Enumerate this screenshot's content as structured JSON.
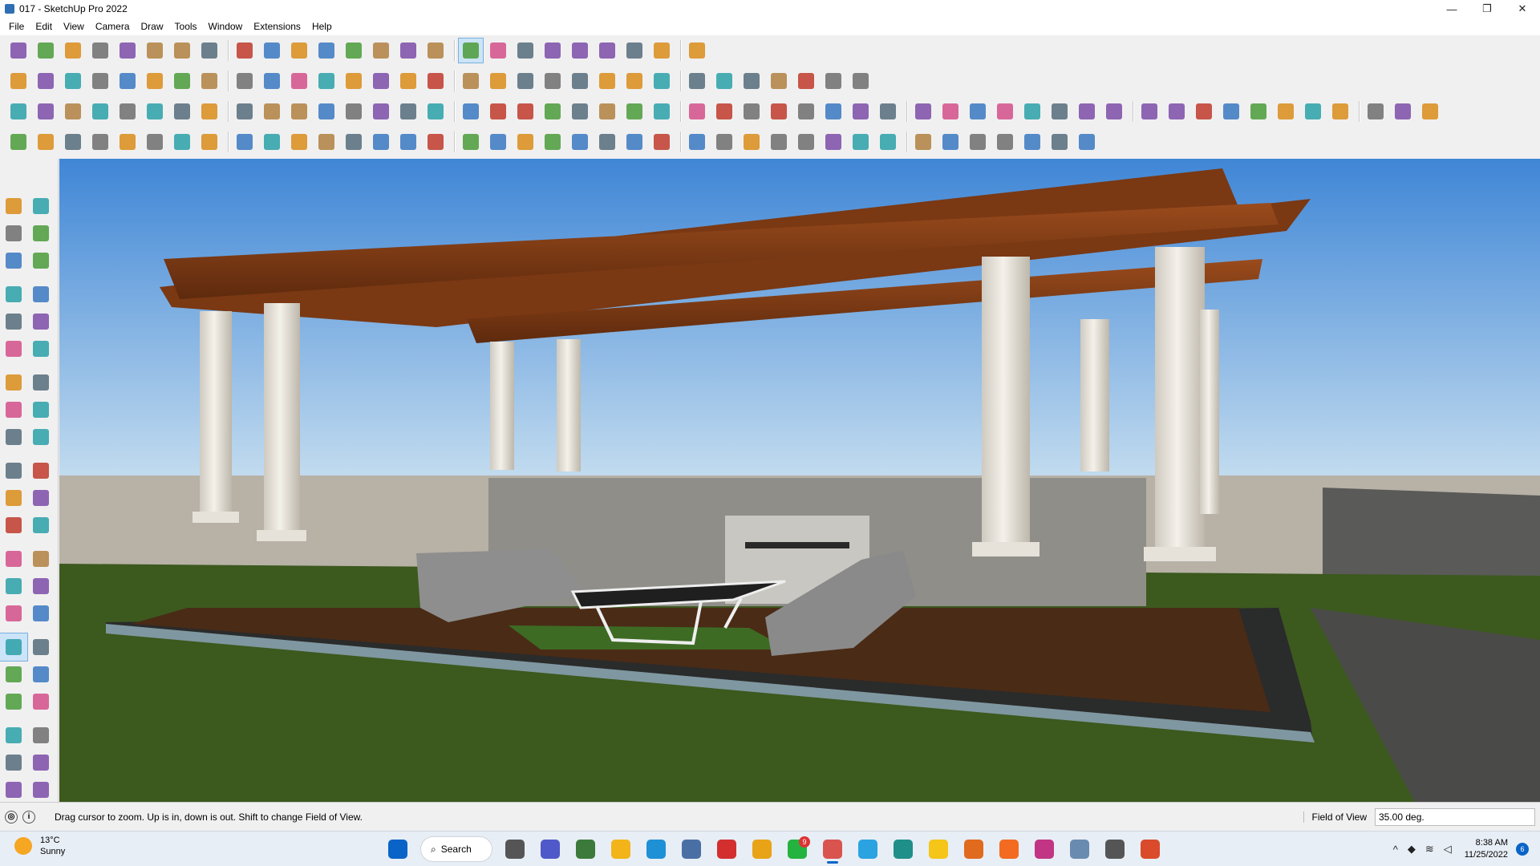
{
  "window": {
    "title": "017 - SketchUp Pro 2022",
    "minimize_glyph": "—",
    "maximize_glyph": "❐",
    "close_glyph": "✕"
  },
  "menu": [
    "File",
    "Edit",
    "View",
    "Camera",
    "Draw",
    "Tools",
    "Window",
    "Extensions",
    "Help"
  ],
  "toolbars": {
    "row1": [
      "search-icon",
      "select-icon",
      "eraser-icon",
      "line-icon",
      "arc-icon",
      "rectangle-icon",
      "push-pull-icon",
      "follow-me-icon",
      "move-icon",
      "rotate-icon",
      "scale-icon",
      "tape-measure-icon",
      "text-icon",
      "paint-bucket-icon",
      "orbit-icon",
      "pan-icon",
      "zoom-icon",
      "zoom-extents-icon",
      "warehouse-icon",
      "extension-warehouse-icon",
      "layout-icon",
      "extension-manager-icon",
      "profile-icon",
      "sandbox-icon",
      "tag-icon"
    ],
    "row2": [
      "warehouse-house-icon",
      "box-icon",
      "section-icon",
      "xray-icon",
      "wireframe-icon",
      "hidden-line-icon",
      "shaded-icon",
      "textured-icon",
      "monochrome-icon",
      "solid-union-icon",
      "solid-subtract-icon",
      "solid-trim-icon",
      "paint-icon",
      "pencil-icon",
      "circle-icon",
      "polygon-icon",
      "ellipse-icon",
      "parallelogram-icon",
      "curve-icon",
      "oval-icon",
      "cloud-icon",
      "arrow-icon",
      "eraser2-icon",
      "push-red-icon",
      "push-blue-icon",
      "push-green-icon",
      "push-orange-icon",
      "push-purple-icon",
      "push-gold-icon",
      "tree-icon",
      "plant-icon"
    ],
    "row3": [
      "component-icon",
      "bend-icon",
      "round-icon",
      "protractor-icon",
      "axes-icon",
      "star-icon",
      "arc3-icon",
      "group-icon",
      "intersect-icon",
      "face-icon",
      "grid-icon",
      "copy-icon",
      "flip-icon",
      "mirror-icon",
      "sphere-icon",
      "cylinder-icon",
      "hand-cursor-icon",
      "shell-icon",
      "soften-icon",
      "cup-icon",
      "sphere2-icon",
      "torus-icon",
      "refresh-icon",
      "dimension-icon",
      "level-icon",
      "window-icon",
      "frame-icon",
      "door-icon",
      "lock-icon",
      "curve-path-icon",
      "dots-icon",
      "weld-icon",
      "split-icon",
      "knife-icon",
      "loop-icon",
      "twist-icon",
      "coil-icon",
      "ribbon-icon",
      "stairs-icon",
      "fan-icon",
      "railing-icon",
      "wave-icon",
      "comb-icon",
      "spring-icon",
      "fence-icon",
      "fin-icon",
      "slope-icon",
      "spline-icon",
      "chevron-icon",
      "feather-icon",
      "branch-icon"
    ],
    "row4": [
      "plane-blue-icon",
      "plane-blue2-icon",
      "plane-yellow-icon",
      "plane-green-icon",
      "plane-red-icon",
      "plane-grey-icon",
      "spiral-icon",
      "red-block-icon",
      "table-icon",
      "flag-icon",
      "box-brown-icon",
      "chain-icon",
      "hook-icon",
      "dot-path-icon",
      "red-cross-icon",
      "green-cross-icon",
      "blue-x-icon",
      "cone-icon",
      "fountain-icon",
      "warning-icon",
      "lasso-icon",
      "knot-icon",
      "loop2-icon",
      "compass-icon",
      "barrel-icon",
      "undo-red-icon",
      "tree-green-icon",
      "gear-blue-icon",
      "gear-red-icon",
      "gear-red2-icon",
      "gem-icon",
      "module-icon",
      "monitor-icon",
      "tile-orange-icon",
      "tile-grid-icon",
      "tile-brick-icon",
      "scatter-icon",
      "curve-dots-icon",
      "cluster-icon"
    ]
  },
  "left_toolbar": [
    "select-icon",
    "orbit-arrow-icon",
    "paint-bucket-icon",
    "eraser-icon",
    "make-component-icon",
    "tag-icon",
    "pencil-icon",
    "freehand-icon",
    "rectangle-icon",
    "rotated-rectangle-icon",
    "circle-icon",
    "polygon-icon",
    "arc-icon",
    "two-point-arc-icon",
    "pie-icon",
    "three-point-arc-icon",
    "move-icon",
    "push-pull-icon",
    "rotate-icon",
    "follow-me-icon",
    "scale-icon",
    "offset-icon",
    "tape-measure-icon",
    "dimension-icon",
    "protractor-icon",
    "text-icon",
    "axes-icon",
    "3d-text-icon",
    "orbit-icon",
    "pan-icon",
    "zoom-icon",
    "zoom-window-icon",
    "zoom-extents-icon",
    "previous-view-icon",
    "position-camera-icon",
    "look-around-icon",
    "walk-icon",
    "section-plane-icon",
    "warehouse-icon",
    "extension-warehouse-icon",
    "layout-icon",
    "extension-manager-icon"
  ],
  "status": {
    "hint": "Drag cursor to zoom.  Up is in, down is out. Shift to change Field of View.",
    "fov_label": "Field of View",
    "fov_value": "35.00 deg."
  },
  "taskbar": {
    "weather_temp": "13°C",
    "weather_desc": "Sunny",
    "search_label": "Search",
    "apps": [
      "windows-start-icon",
      "task-view-icon",
      "teams-icon",
      "calculator-icon",
      "file-explorer-icon",
      "edge-icon",
      "store-icon",
      "opera-icon",
      "chrome-icon",
      "whatsapp-icon",
      "sketchup-icon",
      "telegram-icon",
      "app-teal-icon",
      "sticky-notes-icon",
      "garmin-icon",
      "soundcloud-icon",
      "instagram-icon",
      "photo-icon",
      "tool-icon",
      "sketchup-layout-icon"
    ],
    "whatsapp_badge": "9",
    "time": "8:38 AM",
    "date": "11/25/2022",
    "notif_count": "6"
  },
  "colors": {
    "sky_top": "#4a90d8",
    "sky_bottom": "#bcd8ee",
    "grass": "#3d5a1e",
    "wood": "#7a3a14",
    "column": "#ece9e2",
    "wall": "#b9b4ab",
    "accent": "#0a64c8"
  }
}
